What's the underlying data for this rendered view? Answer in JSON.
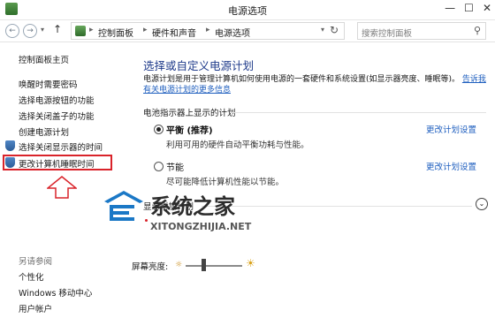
{
  "window": {
    "title": "电源选项"
  },
  "address": {
    "crumbs": [
      "控制面板",
      "硬件和声音",
      "电源选项"
    ],
    "search_placeholder": "搜索控制面板"
  },
  "leftnav": {
    "home": "控制面板主页",
    "items": [
      "唤醒时需要密码",
      "选择电源按钮的功能",
      "选择关闭盖子的功能",
      "创建电源计划",
      "选择关闭显示器的时间",
      "更改计算机睡眠时间"
    ],
    "also_see": "另请参阅",
    "also_items": [
      "个性化",
      "Windows 移动中心",
      "用户帐户"
    ]
  },
  "main": {
    "heading": "选择或自定义电源计划",
    "description": "电源计划是用于管理计算机如何使用电源的一套硬件和系统设置(如显示器亮度、睡眠等)。",
    "more_link": "告诉我有关电源计划的更多信息",
    "group_label": "电池指示器上显示的计划",
    "plans": [
      {
        "name": "平衡 (推荐)",
        "desc": "利用可用的硬件自动平衡功耗与性能。",
        "link": "更改计划设置",
        "selected": true
      },
      {
        "name": "节能",
        "desc": "尽可能降低计算机性能以节能。",
        "link": "更改计划设置",
        "selected": false
      }
    ],
    "extra_label": "显示附加计划"
  },
  "watermark": {
    "brand": "系统之家",
    "url": "XITONGZHIJIA.NET"
  },
  "bottom": {
    "brightness_label": "屏幕亮度:"
  },
  "colors": {
    "accent": "#1f5fbf",
    "heading": "#1e3a8a",
    "highlight": "#d9232a"
  }
}
